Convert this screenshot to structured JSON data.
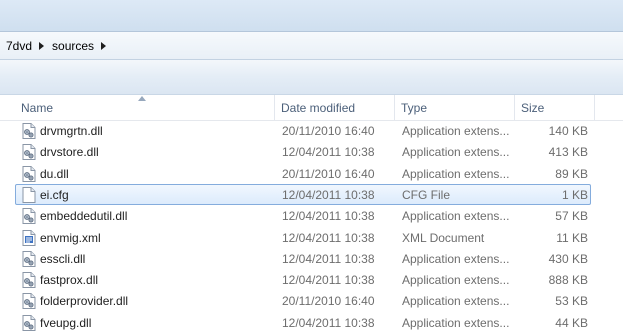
{
  "address": {
    "crumbs": [
      "7dvd",
      "sources"
    ]
  },
  "columns": {
    "name": "Name",
    "date": "Date modified",
    "type": "Type",
    "size": "Size"
  },
  "files": [
    {
      "name": "drvmgrtn.dll",
      "date": "20/11/2010 16:40",
      "type": "Application extens...",
      "size": "140 KB",
      "icon": "dll-icon",
      "selected": false
    },
    {
      "name": "drvstore.dll",
      "date": "12/04/2011 10:38",
      "type": "Application extens...",
      "size": "413 KB",
      "icon": "dll-icon",
      "selected": false
    },
    {
      "name": "du.dll",
      "date": "20/11/2010 16:40",
      "type": "Application extens...",
      "size": "89 KB",
      "icon": "dll-icon",
      "selected": false
    },
    {
      "name": "ei.cfg",
      "date": "12/04/2011 10:38",
      "type": "CFG File",
      "size": "1 KB",
      "icon": "blank-file-icon",
      "selected": true
    },
    {
      "name": "embeddedutil.dll",
      "date": "12/04/2011 10:38",
      "type": "Application extens...",
      "size": "57 KB",
      "icon": "dll-icon",
      "selected": false
    },
    {
      "name": "envmig.xml",
      "date": "12/04/2011 10:38",
      "type": "XML Document",
      "size": "11 KB",
      "icon": "xml-icon",
      "selected": false
    },
    {
      "name": "esscli.dll",
      "date": "12/04/2011 10:38",
      "type": "Application extens...",
      "size": "430 KB",
      "icon": "dll-icon",
      "selected": false
    },
    {
      "name": "fastprox.dll",
      "date": "12/04/2011 10:38",
      "type": "Application extens...",
      "size": "888 KB",
      "icon": "dll-icon",
      "selected": false
    },
    {
      "name": "folderprovider.dll",
      "date": "20/11/2010 16:40",
      "type": "Application extens...",
      "size": "53 KB",
      "icon": "dll-icon",
      "selected": false
    },
    {
      "name": "fveupg.dll",
      "date": "12/04/2011 10:38",
      "type": "Application extens...",
      "size": "44 KB",
      "icon": "dll-icon",
      "selected": false
    }
  ]
}
